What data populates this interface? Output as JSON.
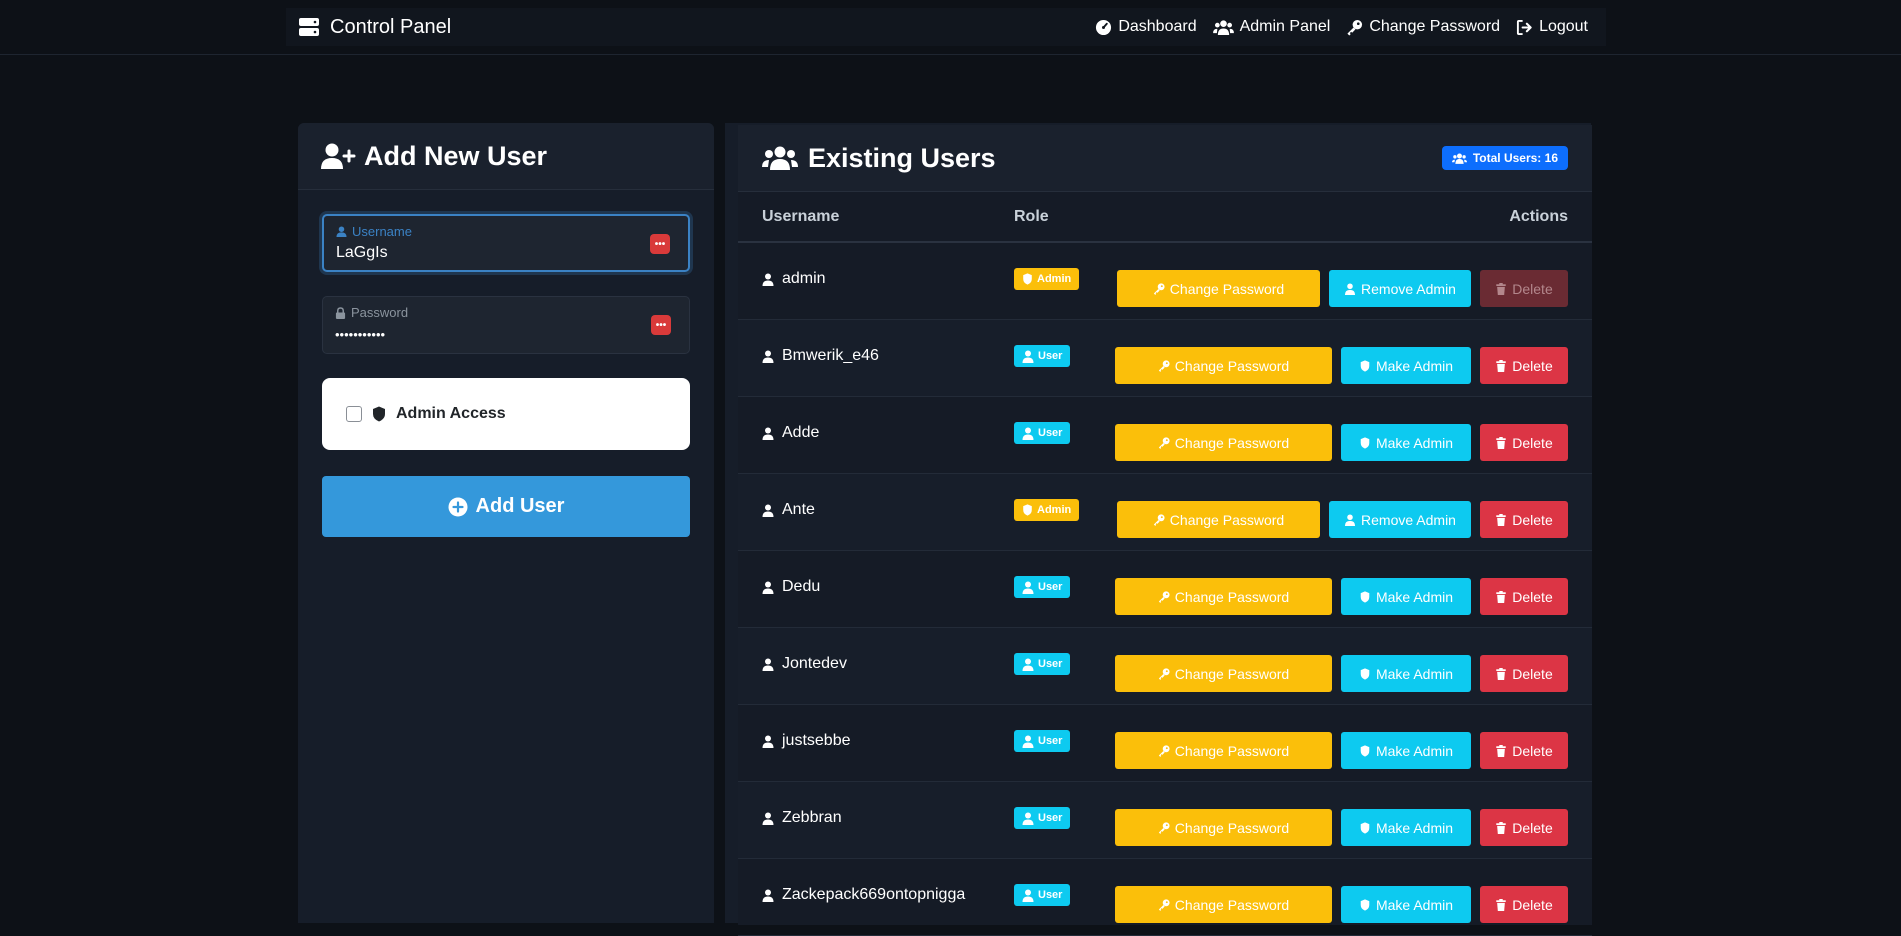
{
  "navbar": {
    "brand": "Control Panel",
    "links": [
      {
        "label": "Dashboard",
        "icon": "gauge-icon"
      },
      {
        "label": "Admin Panel",
        "icon": "users-icon"
      },
      {
        "label": "Change Password",
        "icon": "key-icon"
      },
      {
        "label": "Logout",
        "icon": "logout-icon"
      }
    ]
  },
  "add_user": {
    "title": "Add New User",
    "username_label": "Username",
    "username_value": "LaGgIs",
    "password_label": "Password",
    "password_value": "•••••••••••",
    "admin_access_label": "Admin Access",
    "admin_access_checked": false,
    "submit_label": "Add User"
  },
  "users": {
    "title": "Existing Users",
    "total_label": "Total Users: 16",
    "columns": {
      "username": "Username",
      "role": "Role",
      "actions": "Actions"
    },
    "actions": {
      "change_password": "Change Password",
      "make_admin": "Make Admin",
      "remove_admin": "Remove Admin",
      "delete": "Delete"
    },
    "rows": [
      {
        "username": "admin",
        "role": "Admin",
        "delete_disabled": true
      },
      {
        "username": "Bmwerik_e46",
        "role": "User",
        "delete_disabled": false
      },
      {
        "username": "Adde",
        "role": "User",
        "delete_disabled": false
      },
      {
        "username": "Ante",
        "role": "Admin",
        "delete_disabled": false
      },
      {
        "username": "Dedu",
        "role": "User",
        "delete_disabled": false
      },
      {
        "username": "Jontedev",
        "role": "User",
        "delete_disabled": false
      },
      {
        "username": "justsebbe",
        "role": "User",
        "delete_disabled": false
      },
      {
        "username": "Zebbran",
        "role": "User",
        "delete_disabled": false
      },
      {
        "username": "Zackepack669ontopnigga",
        "role": "User",
        "delete_disabled": false
      }
    ]
  },
  "colors": {
    "background": "#0d1117",
    "warning": "#fbbf0a",
    "info": "#0dcaf0",
    "danger": "#dc3545",
    "primary": "#0d6efd",
    "add_button": "#3498db"
  }
}
